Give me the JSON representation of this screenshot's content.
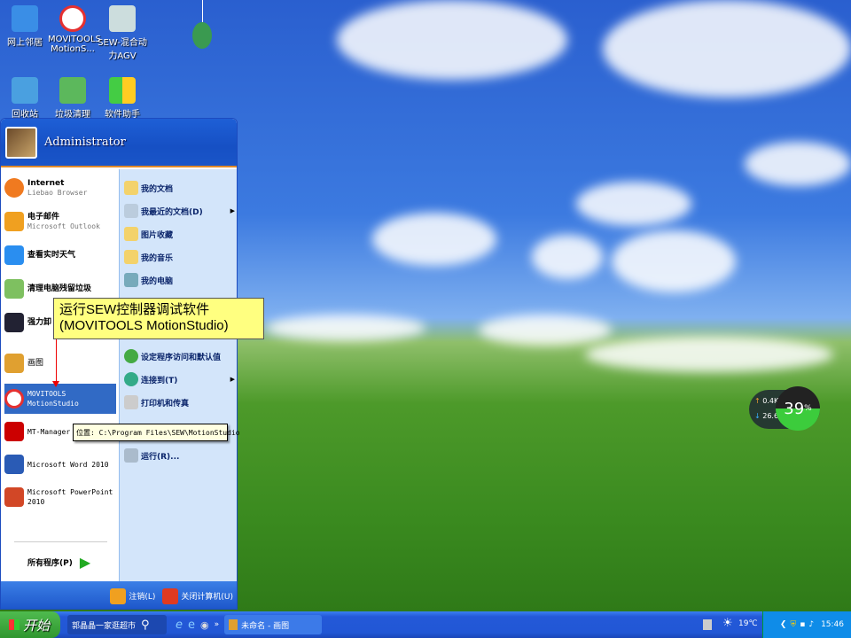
{
  "desktop_icons": [
    {
      "label": "网上邻居",
      "color": "#3a8ee6"
    },
    {
      "label": "MOVITOOLS MotionS...",
      "color": "#e53030"
    },
    {
      "label": "SEW-混合动力AGV",
      "color": "#9ab"
    },
    {
      "label": "回收站",
      "color": "#4aa0e0"
    },
    {
      "label": "垃圾清理",
      "color": "#5cb85c"
    },
    {
      "label": "软件助手",
      "color": "#f0c020"
    }
  ],
  "start_menu": {
    "user": "Administrator",
    "left_items": [
      {
        "title": "Internet",
        "sub": "Liebao Browser",
        "color": "#f07a20"
      },
      {
        "title": "电子邮件",
        "sub": "Microsoft Outlook",
        "color": "#f0a020"
      },
      {
        "title": "查看实时天气",
        "sub": "",
        "color": "#2a8ef0"
      },
      {
        "title": "清理电脑残留垃圾",
        "sub": "",
        "color": "#7ec060"
      },
      {
        "title": "强力卸",
        "sub": "",
        "color": "#223"
      },
      {
        "title": "画图",
        "sub": "",
        "color": "#e0a030"
      },
      {
        "title": "MOVITOOLS MotionStudio",
        "sub": "",
        "color": "#e53030"
      },
      {
        "title": "MT-Manager",
        "sub": "",
        "color": "#c00"
      },
      {
        "title": "Microsoft Word 2010",
        "sub": "",
        "color": "#2a5bb5"
      },
      {
        "title": "Microsoft PowerPoint 2010",
        "sub": "",
        "color": "#d24726"
      }
    ],
    "all_programs": "所有程序(P)",
    "right_items": [
      {
        "label": "我的文档",
        "submenu": false
      },
      {
        "label": "我最近的文档(D)",
        "submenu": true
      },
      {
        "label": "图片收藏",
        "submenu": false
      },
      {
        "label": "我的音乐",
        "submenu": false
      },
      {
        "label": "我的电脑",
        "submenu": false
      },
      {
        "label": "设定程序访问和默认值",
        "submenu": false
      },
      {
        "label": "连接到(T)",
        "submenu": true
      },
      {
        "label": "打印机和传真",
        "submenu": false
      },
      {
        "label": "运行(R)...",
        "submenu": false
      }
    ],
    "logoff": "注销(L)",
    "shutdown": "关闭计算机(U)"
  },
  "callout": {
    "line1": "运行SEW控制器调试软件",
    "line2": "(MOVITOOLS MotionStudio)"
  },
  "tooltip": "位置: C:\\Program Files\\SEW\\MotionStudio",
  "network_widget": {
    "upload": "0.4K/s",
    "download": "26.6K/s",
    "percent": "39",
    "percent_sign": "%"
  },
  "taskbar": {
    "start": "开始",
    "search": "郭晶晶一家逛超市",
    "overflow": "»",
    "window": "未命名 - 画图",
    "weather": "19℃",
    "clock": "15:46"
  }
}
